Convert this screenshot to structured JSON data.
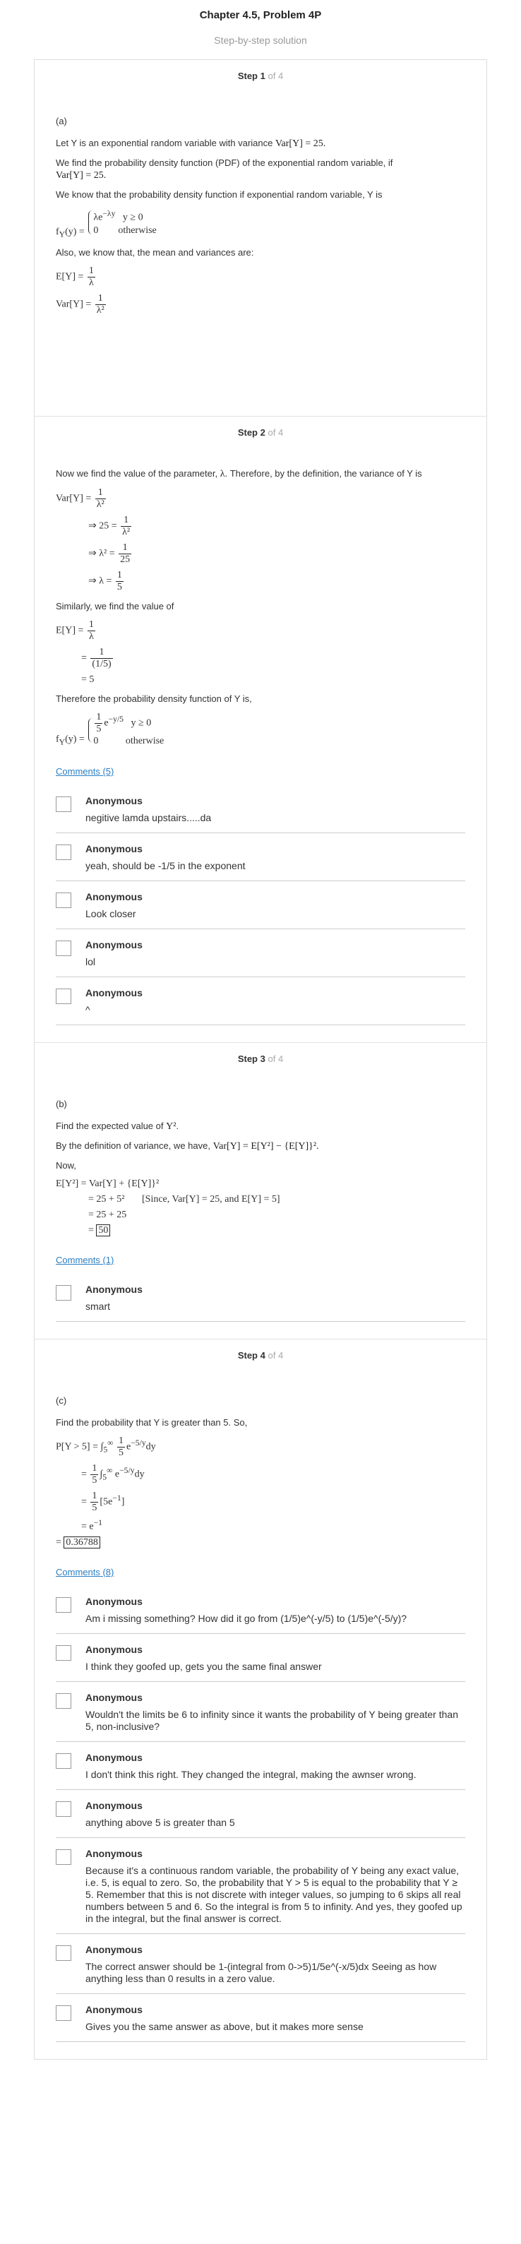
{
  "header": {
    "title": "Chapter 4.5, Problem 4P",
    "subtitle": "Step-by-step solution"
  },
  "step_prefix": "Step",
  "step_of_label": "of 4",
  "steps": [
    {
      "number": "1",
      "part": "(a)",
      "line1": "Let Y is an exponential random variable with variance",
      "line1_math": "Var[Y] = 25.",
      "line2": "We find the probability density function (PDF) of the exponential random variable, if",
      "line2_math": "Var[Y] = 25.",
      "line3": "We know that the probability density function if exponential random variable, Y is",
      "pdf_lhs": "f",
      "pdf_case1": "λe",
      "pdf_case1_cond": "y ≥ 0",
      "pdf_case2": "0",
      "pdf_case2_cond": "otherwise",
      "line4": "Also, we know that, the mean and variances are:",
      "mean_lhs": "E[Y] =",
      "var_lhs": "Var[Y] ="
    },
    {
      "number": "2",
      "line1": "Now we find the value of the parameter,",
      "line1_tail": ". Therefore, by the definition, the variance of Y is",
      "line2": "Similarly, we find the value of",
      "line3": "Therefore the probability density function of Y is,"
    },
    {
      "number": "3",
      "part": "(b)",
      "line1": "Find the expected value of",
      "line2": "By the definition of variance, we have,",
      "line2_math": "Var[Y] = E[Y²] − {E[Y]}².",
      "line3": "Now,",
      "since": "[Since, Var[Y] = 25, and E[Y] = 5]",
      "result": "50"
    },
    {
      "number": "4",
      "part": "(c)",
      "line1": "Find the probability that Y is greater than 5. So,",
      "result": "0.36788"
    }
  ],
  "comment_groups": [
    {
      "link": "Comments (5)",
      "items": [
        {
          "author": "Anonymous",
          "text": "negitive lamda upstairs.....da"
        },
        {
          "author": "Anonymous",
          "text": "yeah, should be -1/5 in the exponent"
        },
        {
          "author": "Anonymous",
          "text": "Look closer"
        },
        {
          "author": "Anonymous",
          "text": "lol"
        },
        {
          "author": "Anonymous",
          "text": "^"
        }
      ]
    },
    {
      "link": "Comments (1)",
      "items": [
        {
          "author": "Anonymous",
          "text": "smart"
        }
      ]
    },
    {
      "link": "Comments (8)",
      "items": [
        {
          "author": "Anonymous",
          "text": "Am i missing something? How did it go from (1/5)e^(-y/5) to (1/5)e^(-5/y)?"
        },
        {
          "author": "Anonymous",
          "text": "I think they goofed up, gets you the same final answer"
        },
        {
          "author": "Anonymous",
          "text": "Wouldn't the limits be 6 to infinity since it wants the probability of Y being greater than 5, non-inclusive?"
        },
        {
          "author": "Anonymous",
          "text": "I don't think this right. They changed the integral, making the awnser wrong."
        },
        {
          "author": "Anonymous",
          "text": "anything above 5 is greater than 5"
        },
        {
          "author": "Anonymous",
          "text": "Because it's a continuous random variable, the probability of Y being any exact value, i.e. 5, is equal to zero. So, the probability that Y > 5 is equal to the probability that Y ≥ 5. Remember that this is not discrete with integer values, so jumping to 6 skips all real numbers between 5 and 6. So the integral is from 5 to infinity. And yes, they goofed up in the integral, but the final answer is correct."
        },
        {
          "author": "Anonymous",
          "text": "The correct answer should be 1-(integral from 0->5)1/5e^(-x/5)dx Seeing as how anything less than 0 results in a zero value."
        },
        {
          "author": "Anonymous",
          "text": "Gives you the same answer as above, but it makes more sense"
        }
      ]
    }
  ]
}
